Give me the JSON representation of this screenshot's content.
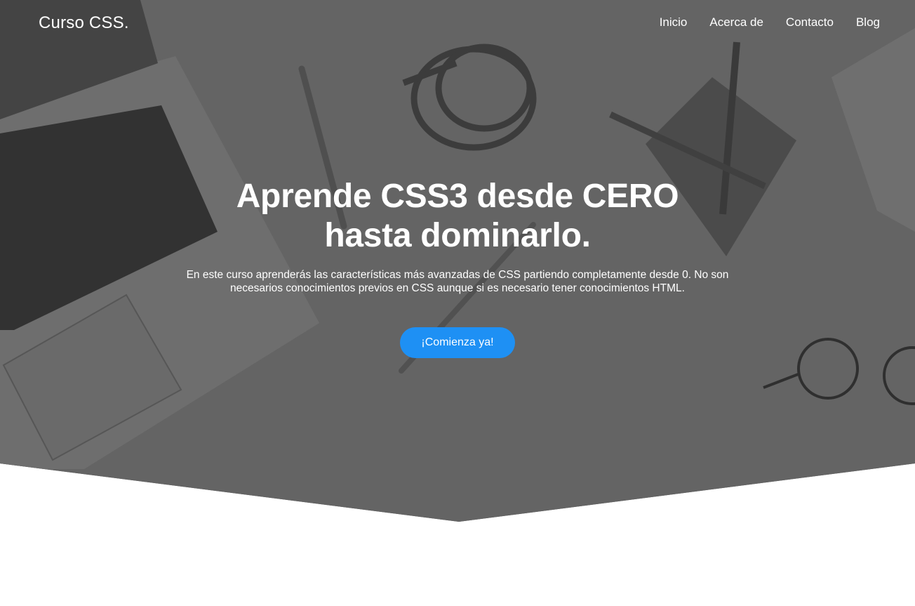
{
  "header": {
    "brand": "Curso CSS.",
    "nav": [
      {
        "label": "Inicio"
      },
      {
        "label": "Acerca de"
      },
      {
        "label": "Contacto"
      },
      {
        "label": "Blog"
      }
    ]
  },
  "hero": {
    "title": "Aprende CSS3 desde CERO hasta dominarlo.",
    "description": "En este curso aprenderás las características más avanzadas de CSS partiendo completamente desde 0. No son necesarios conocimientos previos en CSS aunque si es necesario tener conocimientos HTML.",
    "cta_label": "¡Comienza ya!"
  },
  "colors": {
    "overlay": "#6a6a6a",
    "accent": "#1e90f4",
    "text": "#ffffff"
  }
}
